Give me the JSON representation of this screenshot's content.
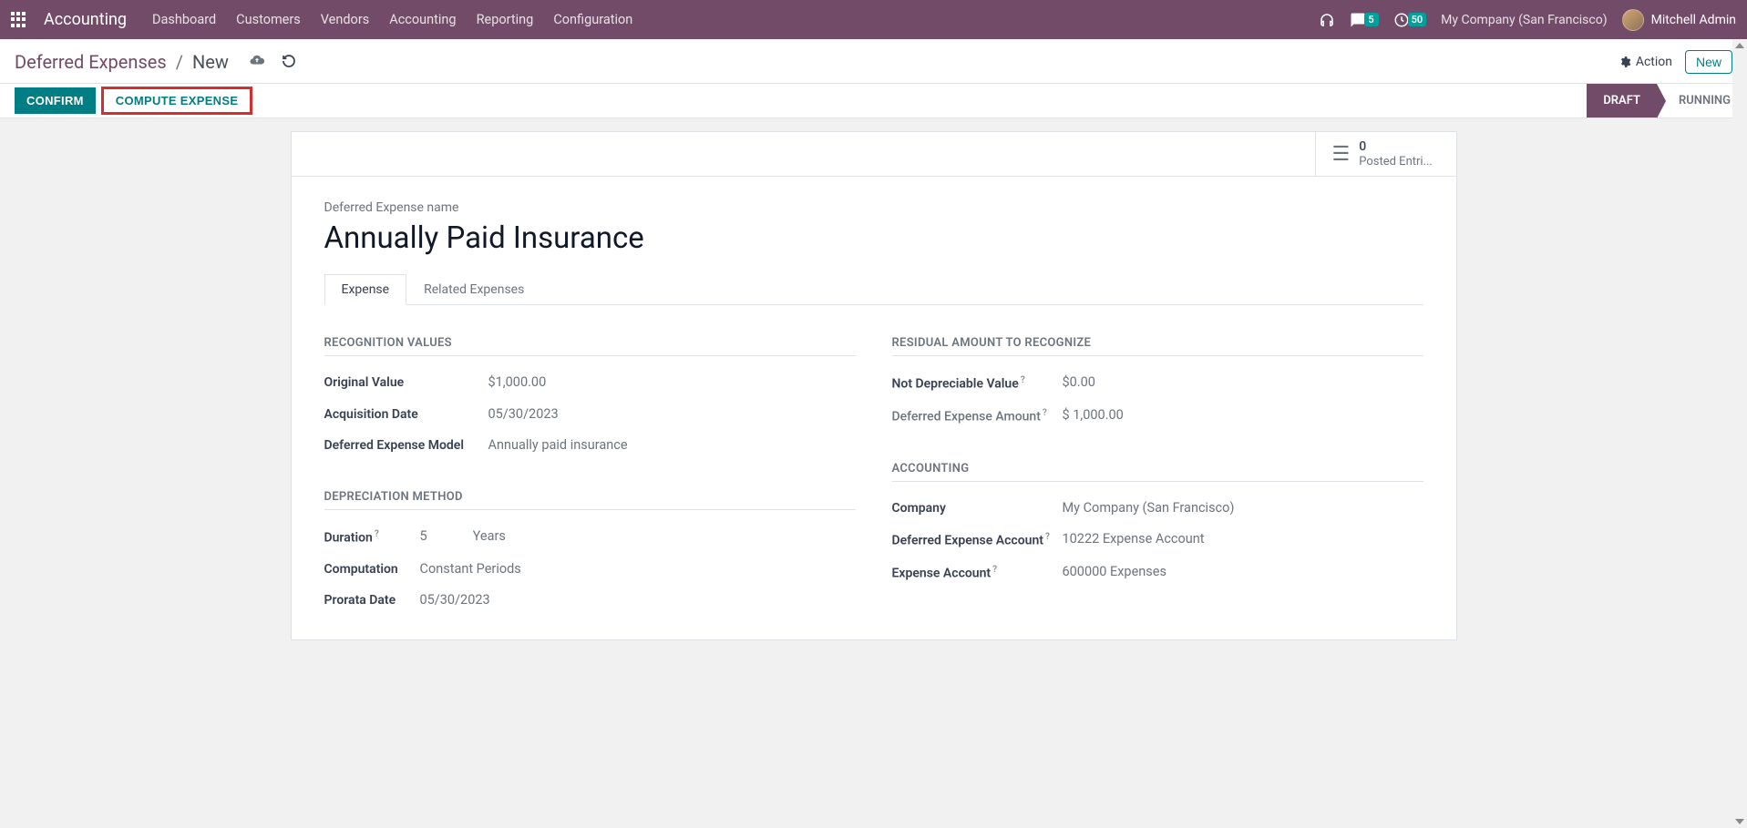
{
  "nav": {
    "app": "Accounting",
    "menu": [
      "Dashboard",
      "Customers",
      "Vendors",
      "Accounting",
      "Reporting",
      "Configuration"
    ],
    "msg_badge": "5",
    "activity_badge": "50",
    "company": "My Company (San Francisco)",
    "user": "Mitchell Admin"
  },
  "cp": {
    "crumb_root": "Deferred Expenses",
    "crumb_sep": "/",
    "crumb_current": "New",
    "action_label": "Action",
    "new_label": "New"
  },
  "status": {
    "confirm": "CONFIRM",
    "compute": "COMPUTE EXPENSE",
    "draft": "DRAFT",
    "running": "RUNNING"
  },
  "stat": {
    "count": "0",
    "label": "Posted Entri..."
  },
  "form": {
    "title_label": "Deferred Expense name",
    "title_value": "Annually Paid Insurance",
    "tabs": {
      "expense": "Expense",
      "related": "Related Expenses"
    },
    "sections": {
      "recognition": "RECOGNITION VALUES",
      "residual": "RESIDUAL AMOUNT TO RECOGNIZE",
      "depreciation": "DEPRECIATION METHOD",
      "accounting": "ACCOUNTING"
    },
    "fields": {
      "original_value": {
        "label": "Original Value",
        "value": "$1,000.00"
      },
      "acq_date": {
        "label": "Acquisition Date",
        "value": "05/30/2023"
      },
      "model": {
        "label": "Deferred Expense Model",
        "value": "Annually paid insurance"
      },
      "not_depr": {
        "label": "Not Depreciable Value",
        "value": "$0.00"
      },
      "def_amount": {
        "label": "Deferred Expense Amount",
        "value": "$ 1,000.00"
      },
      "duration": {
        "label": "Duration",
        "value": "5",
        "unit": "Years"
      },
      "computation": {
        "label": "Computation",
        "value": "Constant Periods"
      },
      "prorata": {
        "label": "Prorata Date",
        "value": "05/30/2023"
      },
      "company": {
        "label": "Company",
        "value": "My Company (San Francisco)"
      },
      "def_account": {
        "label": "Deferred Expense Account",
        "value": "10222 Expense Account"
      },
      "exp_account": {
        "label": "Expense Account",
        "value": "600000 Expenses"
      }
    }
  }
}
